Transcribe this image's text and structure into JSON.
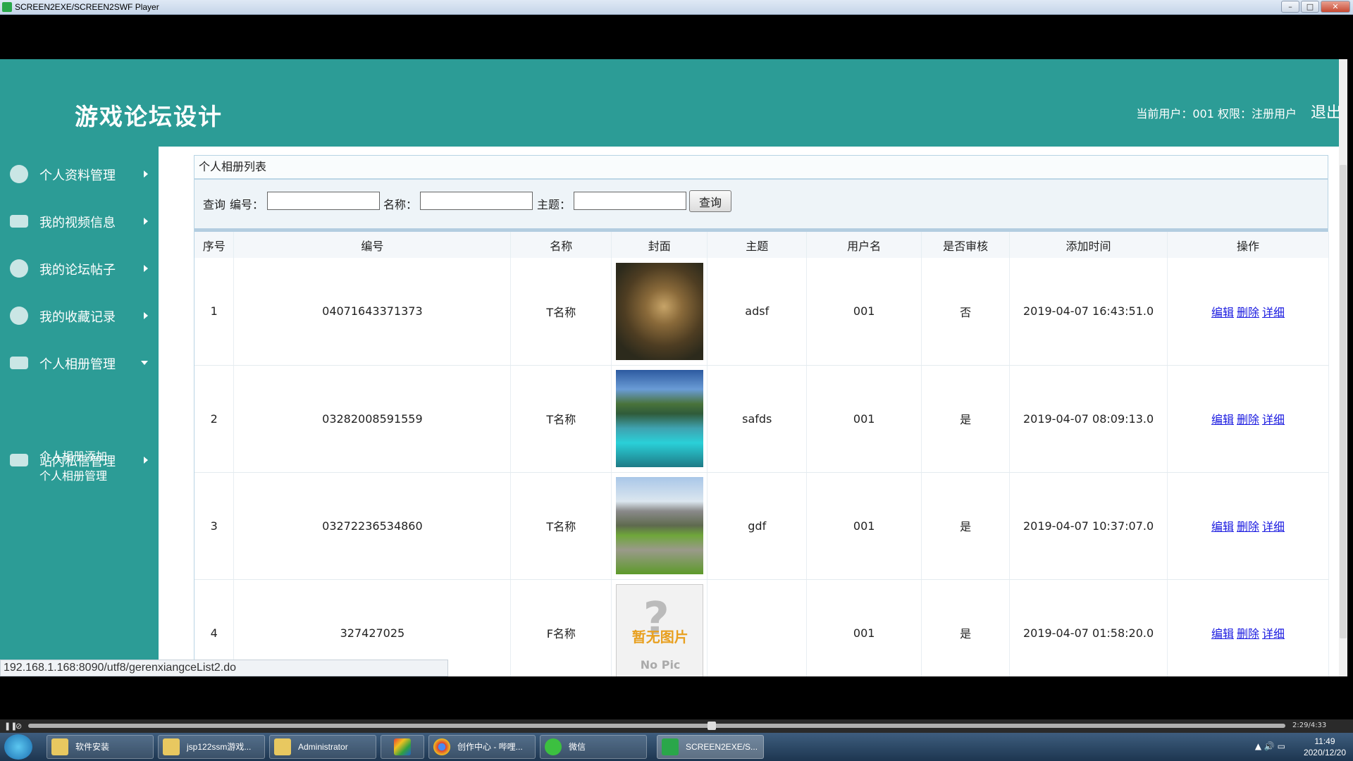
{
  "window": {
    "title": "SCREEN2EXE/SCREEN2SWF Player",
    "controls": [
      "–",
      "□",
      "✕"
    ]
  },
  "header": {
    "title": "游戏论坛设计",
    "user_info": "当前用户：001  权限：注册用户",
    "logout": "退出"
  },
  "sidebar": {
    "items": [
      {
        "label": "个人资料管理",
        "icon": "user-profile-icon"
      },
      {
        "label": "我的视频信息",
        "icon": "video-icon"
      },
      {
        "label": "我的论坛帖子",
        "icon": "forum-icon"
      },
      {
        "label": "我的收藏记录",
        "icon": "app-icon"
      },
      {
        "label": "个人相册管理",
        "icon": "album-icon",
        "expanded": true
      },
      {
        "label": "站内私信管理",
        "icon": "message-icon"
      }
    ],
    "sub_items": [
      "个人相册添加",
      "个人相册管理"
    ]
  },
  "panel": {
    "title": "个人相册列表"
  },
  "search": {
    "query_label": "查询",
    "code_label": "编号：",
    "name_label": "名称：",
    "theme_label": "主题：",
    "button": "查询",
    "code_value": "",
    "name_value": "",
    "theme_value": ""
  },
  "table": {
    "headers": [
      "序号",
      "编号",
      "名称",
      "封面",
      "主题",
      "用户名",
      "是否审核",
      "添加时间",
      "操作"
    ],
    "rows": [
      {
        "index": "1",
        "code": "04071643371373",
        "name": "T名称",
        "theme": "adsf",
        "user": "001",
        "audited": "否",
        "time": "2019-04-07 16:43:51.0"
      },
      {
        "index": "2",
        "code": "03282008591559",
        "name": "T名称",
        "theme": "safds",
        "user": "001",
        "audited": "是",
        "time": "2019-04-07 08:09:13.0"
      },
      {
        "index": "3",
        "code": "03272236534860",
        "name": "T名称",
        "theme": "gdf",
        "user": "001",
        "audited": "是",
        "time": "2019-04-07 10:37:07.0"
      },
      {
        "index": "4",
        "code": "327427025",
        "name": "F名称",
        "theme": "",
        "user": "001",
        "audited": "是",
        "time": "2019-04-07 01:58:20.0"
      }
    ],
    "ops": [
      "编辑",
      "删除",
      "详细"
    ],
    "no_pic_text": "暂无图片",
    "no_pic_en": "No Pic"
  },
  "status_url": "192.168.1.168:8090/utf8/gerenxiangceList2.do",
  "player": {
    "time": "2:29/4:33"
  },
  "taskbar": {
    "tasks": [
      "软件安装",
      "jsp122ssm游戏...",
      "Administrator",
      "",
      "创作中心 - 哔哩...",
      "微信",
      "SCREEN2EXE/S..."
    ],
    "clock_time": "11:49",
    "clock_date": "2020/12/20"
  },
  "colors": {
    "theme_teal": "#2c9c96",
    "link_blue": "#1a1ae0"
  }
}
